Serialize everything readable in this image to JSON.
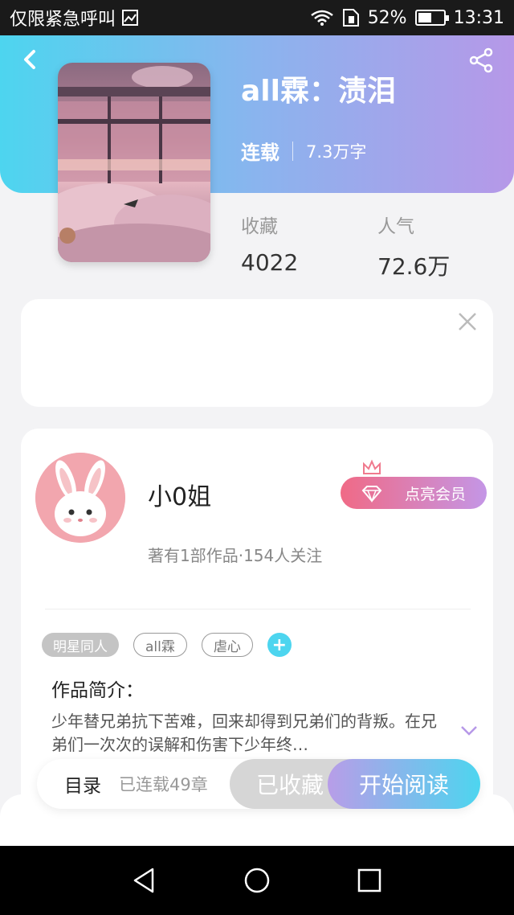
{
  "status_bar": {
    "carrier": "仅限紧急呼叫",
    "battery": "52%",
    "battery_level": 0.52,
    "time": "13:31"
  },
  "header": {
    "back_icon": "chevron-left-icon",
    "share_icon": "share-icon",
    "gradient_colors": [
      "#4dd5ef",
      "#b698e8"
    ]
  },
  "book": {
    "title": "all霖：渍泪",
    "status": "连载",
    "word_count": "7.3万字",
    "stats": {
      "favorites_label": "收藏",
      "favorites_value": "4022",
      "popularity_label": "人气",
      "popularity_value": "72.6万"
    }
  },
  "ad": {
    "close_icon": "close-icon"
  },
  "author": {
    "name": "小0姐",
    "info": "著有1部作品·154人关注",
    "vip_label": "点亮会员"
  },
  "tags": {
    "primary": "明星同人",
    "items": [
      "all霖",
      "虐心"
    ],
    "add_symbol": "+"
  },
  "intro": {
    "title": "作品简介：",
    "text": "少年替兄弟抗下苦难，回来却得到兄弟们的背叛。在兄弟们一次次的误解和伤害下少年终…"
  },
  "action_bar": {
    "catalog": "目录",
    "chapters": "已连载49章",
    "collected": "已收藏",
    "start_reading": "开始阅读"
  },
  "nav": {
    "back": "nav-back-icon",
    "home": "nav-home-icon",
    "recent": "nav-recent-icon"
  }
}
